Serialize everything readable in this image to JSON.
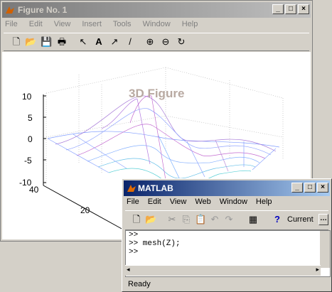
{
  "figure": {
    "title": "Figure No. 1",
    "menu": [
      "File",
      "Edit",
      "View",
      "Insert",
      "Tools",
      "Window",
      "Help"
    ],
    "plot_title": "3D Figure",
    "z_ticks": [
      "10",
      "5",
      "0",
      "-5",
      "-10"
    ],
    "y_ticks": [
      "40",
      "20"
    ],
    "colors": {
      "mesh_low": "#8aa3ff",
      "mesh_high": "#c46bd0",
      "title": "#b8a9a1"
    }
  },
  "matlab": {
    "title": "MATLAB",
    "menu": [
      "File",
      "Edit",
      "View",
      "Web",
      "Window",
      "Help"
    ],
    "current_label": "Current",
    "lines": [
      ">>",
      ">> mesh(Z);",
      ">>"
    ],
    "status": "Ready"
  }
}
